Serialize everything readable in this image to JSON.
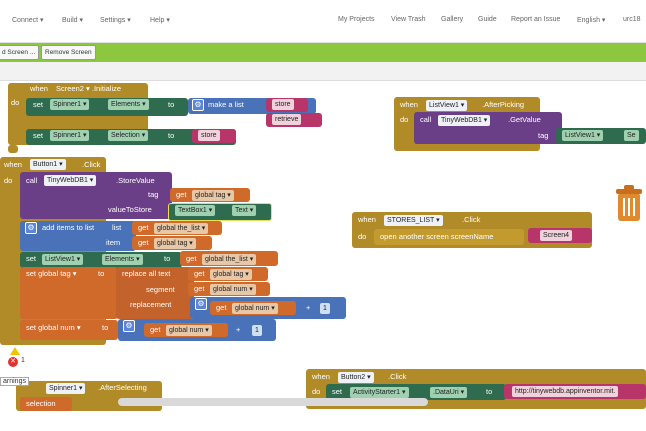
{
  "nav": {
    "connect": "Connect ▾",
    "build": "Build ▾",
    "settings": "Settings ▾",
    "help": "Help ▾",
    "my_projects": "My Projects",
    "view_trash": "View Trash",
    "gallery": "Gallery",
    "guide": "Guide",
    "report_issue": "Report an Issue",
    "english": "English ▾",
    "user": "urc18"
  },
  "toolbar": {
    "add_screen": "d Screen ...",
    "remove_screen": "Remove Screen"
  },
  "blocks": {
    "w_when": "when",
    "w_event": "Screen2 ▾ .Initialize",
    "do": "do",
    "set": "set",
    "to": "to",
    "call": "call",
    "spinner1": "Spinner1 ▾",
    "elements": "Elements ▾",
    "selection": "Selection ▾",
    "make_list": "make a list",
    "store": "store",
    "retrieve": "retrieve",
    "button1": "Button1 ▾",
    "click": ".Click",
    "tinydb": "TinyWebDB1 ▾",
    "storevalue": ".StoreValue",
    "tag": "tag",
    "get": "get",
    "global_tag": "global tag ▾",
    "valuetostore": "valueToStore",
    "textbox1": "TextBox1 ▾",
    "text": "Text ▾",
    "add_items": "add items to list",
    "list": "list",
    "global_the_list": "global the_list ▾",
    "item": "item",
    "listview1": "ListView1 ▾",
    "global_the_list2": "global the_list ▾",
    "set_global_tag": "set  global tag ▾",
    "replace_all": "replace all text",
    "segment": "segment",
    "global_num": "global num ▾",
    "replacement": "replacement",
    "plus": "+",
    "one": "1",
    "set_global_num": "set  global num ▾",
    "afterpicking": ".AfterPicking",
    "getvalue": ".GetValue",
    "listview1b": "ListView1 ▾",
    "se": "Se",
    "stores_list": "STORES_LIST ▾",
    "open_screen": "open another screen  screenName",
    "screen4": "Screen4",
    "button2": "Button2 ▾",
    "activity": "ActivityStarter1 ▾",
    "datauri": ".DataUri ▾",
    "url": "http://tinywebdb.appinventor.mit.",
    "spinner1b": "Spinner1 ▾",
    "afterselecting": ".AfterSelecting",
    "selection_get": "selection",
    "warn_count": "1",
    "warnings": "arnings"
  },
  "colors": {
    "green": "#8dc63f",
    "gold": "#b08b28",
    "teal": "#2e6b4f",
    "purple": "#6b3f88",
    "pink": "#b8356a",
    "orange": "#d06a2a",
    "blue": "#4a72b8"
  }
}
